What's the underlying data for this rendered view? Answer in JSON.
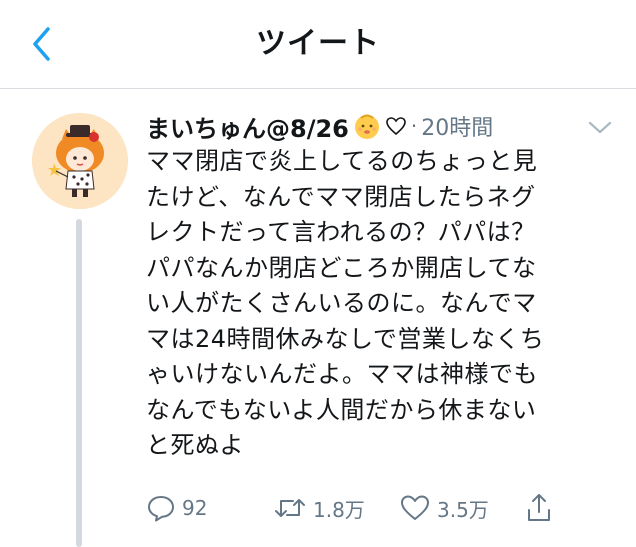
{
  "header": {
    "title": "ツイート",
    "back_icon": "chevron-left-icon"
  },
  "tweet": {
    "author_name": "まいちゅん@8/26",
    "author_emoji": "baby-face-icon",
    "author_heart": "white-heart-icon",
    "separator": "·",
    "time": "20時間",
    "text_lines": [
      "ママ閉店で炎上してるのちょっと見",
      "たけど、なんでママ閉店したらネグ",
      "レクトだって言われるの？パパは？",
      "パパなんか閉店どころか開店してな",
      "い人がたくさんいるのに。なんでマ",
      "マは24時間休みなしで営業しなくち",
      "ゃいけないんだよ。ママは神様でも",
      "なんでもないよ人間だから休まない",
      "と死ぬよ"
    ],
    "actions": {
      "reply_count": "92",
      "retweet_count": "1.8万",
      "like_count": "3.5万"
    }
  },
  "colors": {
    "accent": "#1da1f2",
    "text": "#14171a",
    "secondary": "#657786",
    "divider": "#d9dde1",
    "thread_line": "#d3d9de"
  }
}
